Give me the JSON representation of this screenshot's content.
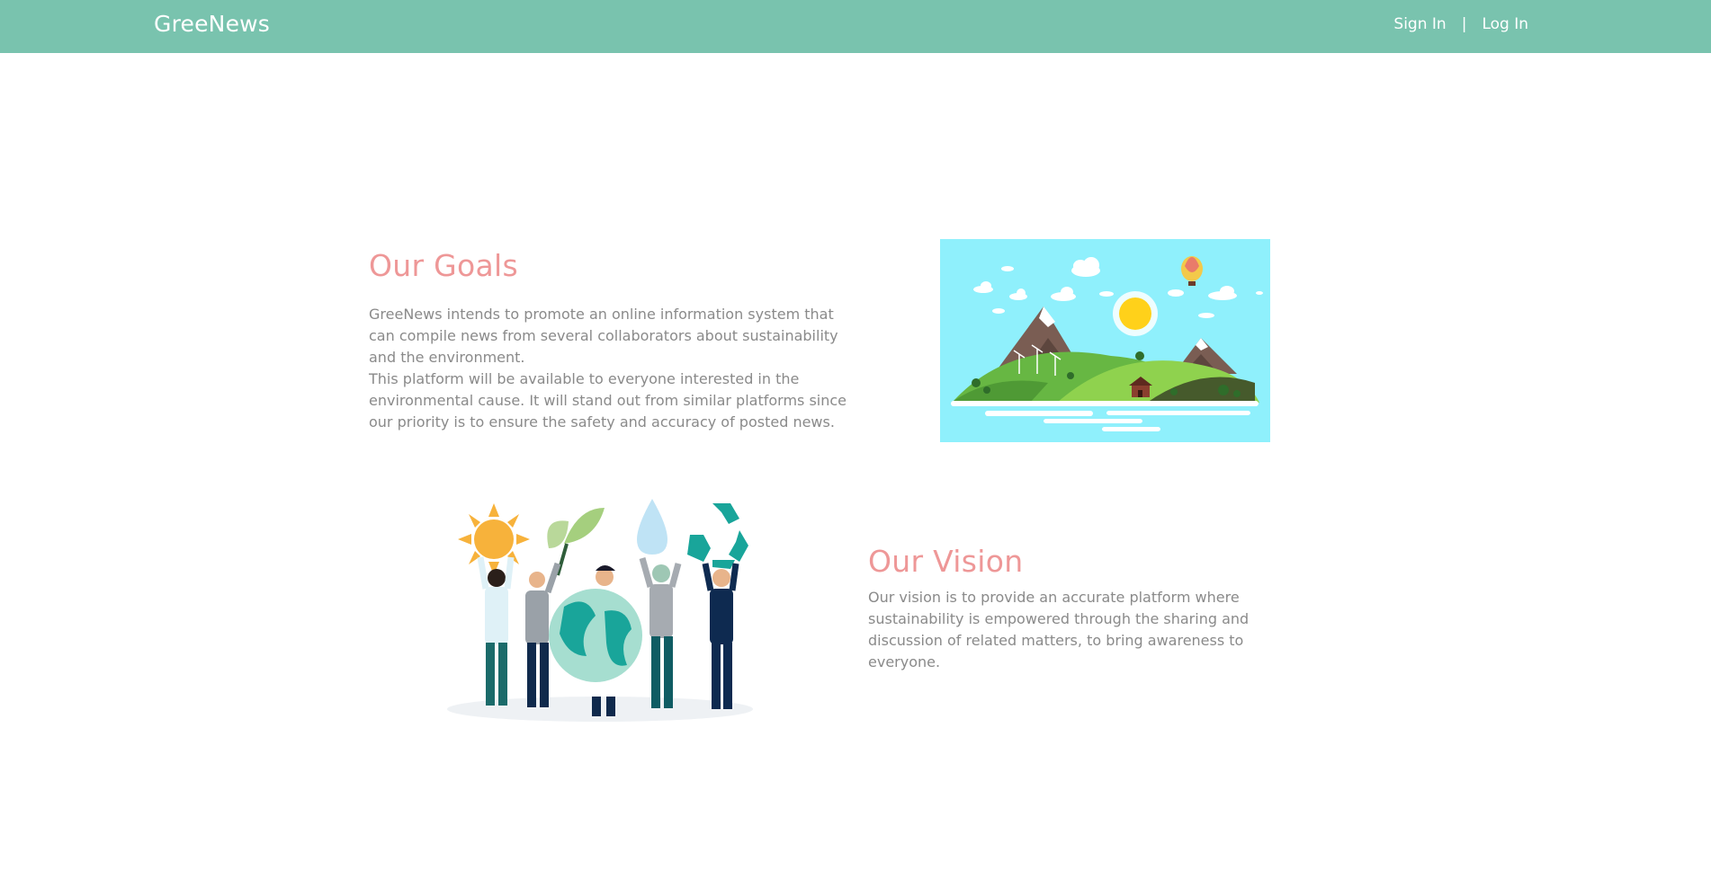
{
  "header": {
    "brand": "GreeNews",
    "nav": {
      "sign_in": "Sign In",
      "separator": "|",
      "log_in": "Log In"
    }
  },
  "goals": {
    "title": "Our Goals",
    "paragraph_1": "GreeNews intends to promote an online information system that can compile news from several collaborators about sustainability and the environment.",
    "paragraph_2": "This platform will be available to everyone interested in the environmental cause. It will stand out from similar platforms since our priority is to ensure the safety and accuracy of posted news."
  },
  "vision": {
    "title": "Our Vision",
    "paragraph": "Our vision is to provide an accurate platform where sustainability is empowered through the sharing and discussion of related matters, to bring awareness to everyone."
  },
  "colors": {
    "header_bg": "#79c3ae",
    "heading": "#ee9797",
    "body_text": "#8a8a8a",
    "sky": "#8ff0fc"
  },
  "images": {
    "goals_illustration": "island-landscape-illustration",
    "vision_illustration": "people-holding-environment-icons-illustration"
  }
}
